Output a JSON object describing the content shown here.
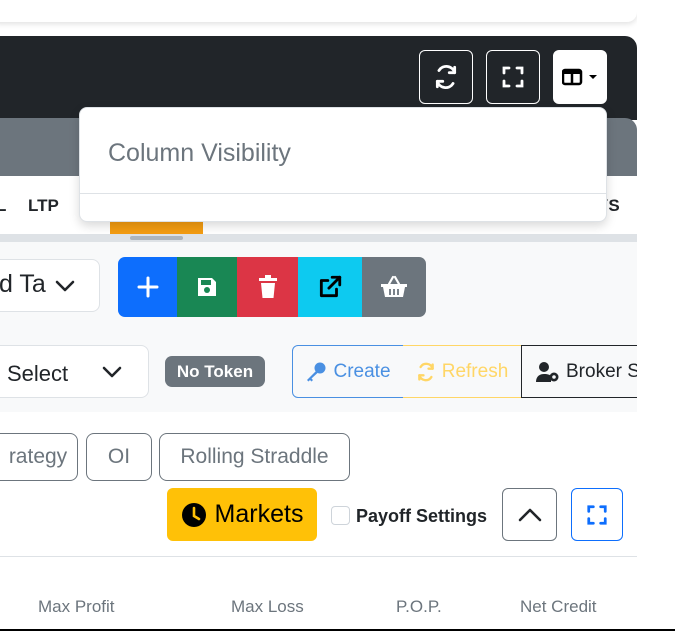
{
  "toolbar": {
    "buttons": [
      {
        "icon": "sync-icon"
      },
      {
        "icon": "expand-icon"
      },
      {
        "icon": "columns-icon"
      }
    ]
  },
  "column_menu": {
    "header": "Column Visibility"
  },
  "table_header": {
    "cells": [
      "L",
      "LTP",
      "YS"
    ]
  },
  "strategy": {
    "select_value": "d Ta",
    "actions": [
      {
        "icon": "plus-icon",
        "color": "#0d6efd"
      },
      {
        "icon": "save-icon",
        "color": "#198754"
      },
      {
        "icon": "trash-icon",
        "color": "#dc3545"
      },
      {
        "icon": "external-link-icon",
        "color": "#0dcaf0"
      },
      {
        "icon": "basket-icon",
        "color": "#6c757d"
      }
    ]
  },
  "broker": {
    "select_value": "Select",
    "token_badge": "No Token",
    "create_label": "Create",
    "refresh_label": "Refresh",
    "broker_label": "Broker S"
  },
  "tabs": [
    "rategy",
    "OI",
    "Rolling Straddle"
  ],
  "controls": {
    "markets_label": "Markets",
    "payoff_label": "Payoff Settings"
  },
  "summary_columns": [
    "Max Profit",
    "Max Loss",
    "P.O.P.",
    "Net Credit"
  ],
  "colors": {
    "dark_bar": "#212529",
    "accent_orange": "#f39c12",
    "markets_yellow": "#ffc107"
  }
}
